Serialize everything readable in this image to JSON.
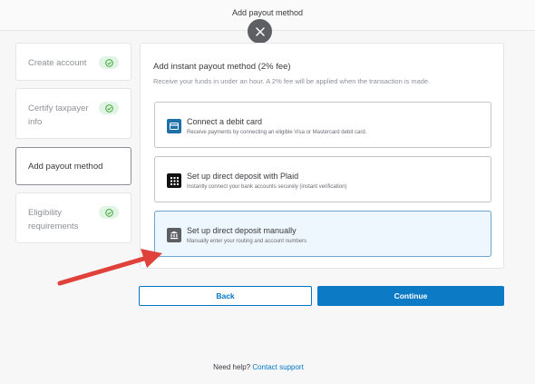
{
  "header": {
    "title": "Add payout method"
  },
  "steps": [
    {
      "label": "Create account",
      "done": true
    },
    {
      "label": "Certify taxpayer info",
      "done": true
    },
    {
      "label": "Add payout method",
      "done": false,
      "active": true
    },
    {
      "label": "Eligibility requirements",
      "done": true
    }
  ],
  "panel": {
    "title": "Add instant payout method (2% fee)",
    "subtitle": "Receive your funds in under an hour. A 2% fee will be applied when the transaction is made.",
    "options": [
      {
        "icon": "credit-card-icon",
        "title": "Connect a debit card",
        "desc": "Receive payments by connecting an eligible Visa or Mastercard debit card."
      },
      {
        "icon": "plaid-logo-icon",
        "title": "Set up direct deposit with Plaid",
        "desc": "Instantly connect your bank accounts securely (instant verification)"
      },
      {
        "icon": "bank-icon",
        "title": "Set up direct deposit manually",
        "desc": "Manually enter your routing and account numbers",
        "selected": true
      }
    ]
  },
  "buttons": {
    "back": "Back",
    "continue": "Continue"
  },
  "help": {
    "text": "Need help?",
    "link": "Contact support"
  },
  "colors": {
    "accent": "#0077c5",
    "check_bg": "#e1f4e6",
    "check": "#2ca01c",
    "arrow": "#e0413b"
  }
}
